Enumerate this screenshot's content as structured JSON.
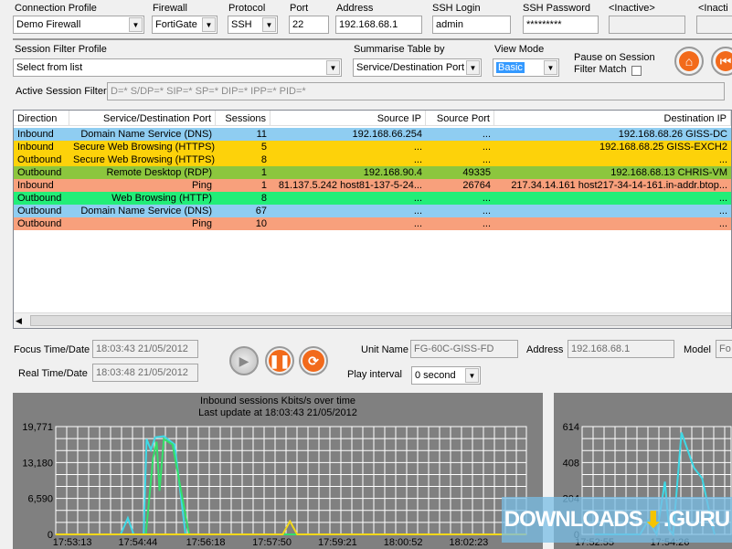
{
  "connection": {
    "profile_label": "Connection Profile",
    "profile_value": "Demo Firewall",
    "firewall_label": "Firewall",
    "firewall_value": "FortiGate",
    "protocol_label": "Protocol",
    "protocol_value": "SSH",
    "port_label": "Port",
    "port_value": "22",
    "address_label": "Address",
    "address_value": "192.168.68.1",
    "ssh_login_label": "SSH Login",
    "ssh_login_value": "admin",
    "ssh_password_label": "SSH Password",
    "ssh_password_value": "*********",
    "inactive1_label": "<Inactive>",
    "inactive2_label": "<Inacti"
  },
  "filter": {
    "session_filter_label": "Session Filter Profile",
    "session_filter_value": "Select from list",
    "summarise_label": "Summarise Table by",
    "summarise_value": "Service/Destination Port",
    "view_mode_label": "View Mode",
    "view_mode_value": "Basic",
    "pause_label_1": "Pause on Session",
    "pause_label_2": "Filter Match",
    "pause_checked": false,
    "active_filter_label": "Active Session Filter",
    "active_filter_value": "D=* S/DP=* SIP=* SP=* DIP=* IPP=* PID=*"
  },
  "table": {
    "columns": [
      "Direction",
      "Service/Destination Port",
      "Sessions",
      "Source IP",
      "Source Port",
      "Destination IP"
    ],
    "rows": [
      {
        "direction": "Inbound",
        "service": "Domain Name Service (DNS)",
        "sessions": "11",
        "source_ip": "192.168.66.254",
        "source_port": "...",
        "dest_ip": "192.168.68.26 GISS-DC",
        "color": "#8fcdf1"
      },
      {
        "direction": "Inbound",
        "service": "Secure Web Browsing (HTTPS)",
        "sessions": "5",
        "source_ip": "...",
        "source_port": "...",
        "dest_ip": "192.168.68.25 GISS-EXCH2",
        "color": "#fdd20a"
      },
      {
        "direction": "Outbound",
        "service": "Secure Web Browsing (HTTPS)",
        "sessions": "8",
        "source_ip": "...",
        "source_port": "...",
        "dest_ip": "...",
        "color": "#fdd20a"
      },
      {
        "direction": "Outbound",
        "service": "Remote Desktop (RDP)",
        "sessions": "1",
        "source_ip": "192.168.90.4",
        "source_port": "49335",
        "dest_ip": "192.168.68.13 CHRIS-VM",
        "color": "#8cc63e"
      },
      {
        "direction": "Inbound",
        "service": "Ping",
        "sessions": "1",
        "source_ip": "81.137.5.242 host81-137-5-24...",
        "source_port": "26764",
        "dest_ip": "217.34.14.161 host217-34-14-161.in-addr.btop...",
        "color": "#f8a07c"
      },
      {
        "direction": "Outbound",
        "service": "Web Browsing (HTTP)",
        "sessions": "8",
        "source_ip": "...",
        "source_port": "...",
        "dest_ip": "...",
        "color": "#22ee78"
      },
      {
        "direction": "Outbound",
        "service": "Domain Name Service (DNS)",
        "sessions": "67",
        "source_ip": "...",
        "source_port": "...",
        "dest_ip": "...",
        "color": "#8fcdf1"
      },
      {
        "direction": "Outbound",
        "service": "Ping",
        "sessions": "10",
        "source_ip": "...",
        "source_port": "...",
        "dest_ip": "...",
        "color": "#f8a07c"
      }
    ]
  },
  "playback": {
    "focus_label": "Focus Time/Date",
    "focus_value": "18:03:43  21/05/2012",
    "real_label": "Real Time/Date",
    "real_value": "18:03:48  21/05/2012",
    "unit_name_label": "Unit Name",
    "unit_name_value": "FG-60C-GISS-FD",
    "address_label": "Address",
    "address_value": "192.168.68.1",
    "model_label": "Model",
    "model_value": "Fo",
    "play_interval_label": "Play interval",
    "play_interval_value": "0 second"
  },
  "watermark": "DOWNLOADS",
  "watermark2": ".GURU",
  "chart_data": [
    {
      "type": "line",
      "title": "Inbound sessions Kbits/s over time",
      "subtitle": "Last update at 18:03:43 21/05/2012",
      "yticks": [
        "19,771",
        "13,180",
        "6,590",
        "0"
      ],
      "ylim": [
        0,
        19771
      ],
      "xticks": [
        "17:53:13",
        "17:54:44",
        "17:56:18",
        "17:57:50",
        "17:59:21",
        "18:00:52",
        "18:02:23"
      ],
      "xlim": [
        "17:52:50",
        "18:03:43"
      ],
      "grid": true,
      "series": [
        {
          "color": "#3fd9e6",
          "points": [
            [
              "17:52:50",
              0
            ],
            [
              "17:54:20",
              0
            ],
            [
              "17:54:30",
              3000
            ],
            [
              "17:54:38",
              0
            ],
            [
              "17:54:52",
              0
            ],
            [
              "17:54:56",
              17500
            ],
            [
              "17:55:02",
              15500
            ],
            [
              "17:55:08",
              17800
            ],
            [
              "17:55:20",
              18000
            ],
            [
              "17:55:35",
              16500
            ],
            [
              "17:55:50",
              0
            ],
            [
              "18:03:43",
              0
            ]
          ]
        },
        {
          "color": "#33e06a",
          "points": [
            [
              "17:52:50",
              0
            ],
            [
              "17:54:55",
              0
            ],
            [
              "17:55:05",
              14000
            ],
            [
              "17:55:10",
              17000
            ],
            [
              "17:55:14",
              8000
            ],
            [
              "17:55:20",
              17500
            ],
            [
              "17:55:32",
              16500
            ],
            [
              "17:55:55",
              0
            ],
            [
              "18:03:43",
              0
            ]
          ]
        },
        {
          "color": "#f2d81a",
          "points": [
            [
              "17:52:50",
              0
            ],
            [
              "17:58:05",
              0
            ],
            [
              "17:58:15",
              2400
            ],
            [
              "17:58:25",
              0
            ],
            [
              "18:03:43",
              0
            ]
          ]
        }
      ]
    },
    {
      "type": "line",
      "yticks": [
        "614",
        "408",
        "204",
        "0"
      ],
      "ylim": [
        0,
        614
      ],
      "xticks": [
        "17:52:55",
        "17:54:26"
      ],
      "grid": true,
      "series": [
        {
          "color": "#3fd9e6",
          "points": [
            [
              "17:52:55",
              0
            ],
            [
              "17:53:50",
              0
            ],
            [
              "17:54:00",
              80
            ],
            [
              "17:54:10",
              0
            ],
            [
              "17:54:20",
              300
            ],
            [
              "17:54:25",
              30
            ],
            [
              "17:54:30",
              0
            ],
            [
              "17:54:40",
              580
            ],
            [
              "17:54:55",
              380
            ],
            [
              "17:55:05",
              320
            ],
            [
              "17:55:15",
              100
            ],
            [
              "17:55:20",
              0
            ]
          ]
        }
      ]
    }
  ]
}
